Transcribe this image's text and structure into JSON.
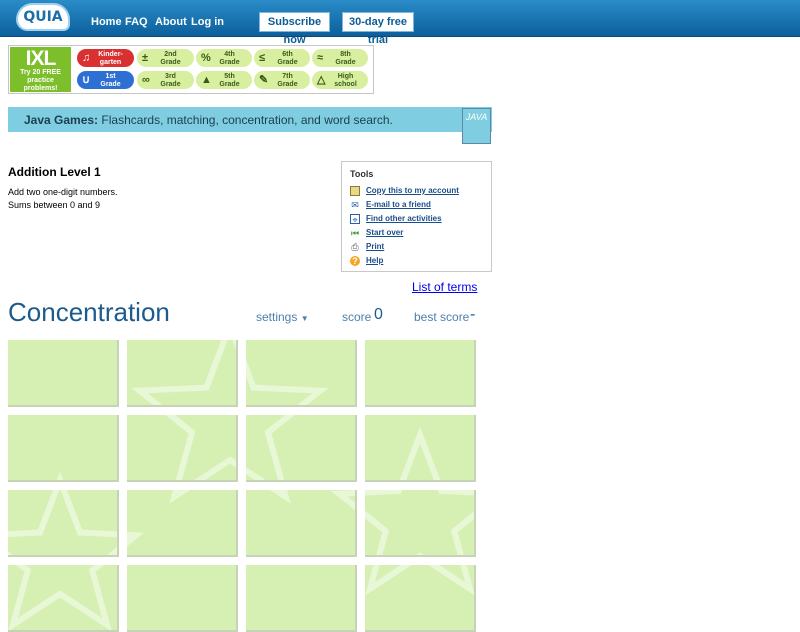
{
  "header": {
    "logo_text": "QUIA",
    "nav": [
      "Home",
      "FAQ",
      "About",
      "Log in"
    ],
    "subscribe_label": "Subscribe now",
    "trial_label": "30-day free trial"
  },
  "ixl": {
    "logo": "IXL",
    "promo": "Try 20 FREE practice problems!",
    "grades": [
      {
        "line1": "Kinder-",
        "line2": "garten",
        "icon": "music-note-icon"
      },
      {
        "line1": "2nd",
        "line2": "Grade",
        "icon": "plus-minus-icon"
      },
      {
        "line1": "4th",
        "line2": "Grade",
        "icon": "percent-icon"
      },
      {
        "line1": "6th",
        "line2": "Grade",
        "icon": "less-equal-icon"
      },
      {
        "line1": "8th",
        "line2": "Grade",
        "icon": "approx-icon"
      },
      {
        "line1": "1st",
        "line2": "Grade",
        "icon": "rabbit-icon"
      },
      {
        "line1": "3rd",
        "line2": "Grade",
        "icon": "infinity-icon"
      },
      {
        "line1": "5th",
        "line2": "Grade",
        "icon": "pyramid-icon"
      },
      {
        "line1": "7th",
        "line2": "Grade",
        "icon": "pencil-icon"
      },
      {
        "line1": "High",
        "line2": "school",
        "icon": "triangle-icon"
      }
    ]
  },
  "java_bar": {
    "bold": "Java Games:",
    "text": "Flashcards, matching, concentration, and word search.",
    "icon_text": "JAVA"
  },
  "activity": {
    "title": "Addition Level 1",
    "desc1": "Add two one-digit numbers.",
    "desc2": "Sums between 0 and 9"
  },
  "tools": {
    "title": "Tools",
    "items": [
      {
        "label": "Copy this to my account",
        "icon": "copy-icon"
      },
      {
        "label": "E-mail to a friend",
        "icon": "email-icon"
      },
      {
        "label": "Find other activities",
        "icon": "search-icon"
      },
      {
        "label": "Start over",
        "icon": "rewind-icon"
      },
      {
        "label": "Print",
        "icon": "printer-icon"
      },
      {
        "label": "Help",
        "icon": "help-icon"
      }
    ]
  },
  "game": {
    "list_terms": "List of terms",
    "title": "Concentration",
    "settings": "settings",
    "score_label": "score",
    "score_value": "0",
    "best_label": "best score",
    "best_value": "-"
  },
  "colors": {
    "topbar": "#0b6aa8",
    "card": "#d6f0b4",
    "java_bar": "#7fcde0",
    "title_blue": "#1b5b8e"
  }
}
